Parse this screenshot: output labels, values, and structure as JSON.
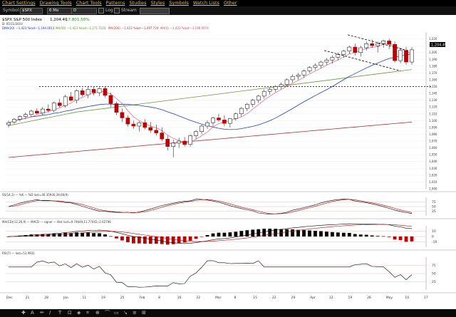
{
  "menu": [
    "Chart Settings",
    "Drawing Tools",
    "Chart Tools",
    "Patterns",
    "Studies",
    "Styles",
    "Symbols",
    "Watch Lists",
    "Other"
  ],
  "toolbar": {
    "symbol_label": "Symbol:",
    "symbol_value": "$SPX",
    "range_value": "6 Mo",
    "period_value": "D",
    "log_label": "Log",
    "stream_label": "Stream"
  },
  "header": {
    "title": "$SPX S&P 500 Index",
    "last_price": "1,204.49",
    "change": "17.80",
    "change_pct": "1.50%",
    "date_line": "D: 05/11/2010",
    "ma_line": "DMA(20) —1,423 %last—1,194.0013",
    "ma_line2": "MA(50) —1,423 %last—1,171.7103",
    "ma_line3": "MA(200) —1,423 %last—1,097.724",
    "ma_line4": "MA(5) —1,423 %last—1,199.5974"
  },
  "price_box": "1,204.49",
  "panels": {
    "stoch_label": "SS(14,3) — %K — %D last=46.35930,39.06(9)",
    "macd_label": "MA(CD)(12,26,9) — MACD — signal — Hist last=9.74649,11.77443,-2.02796",
    "rsi_label": "RSI(7) — last=53.9931"
  },
  "chart_data": {
    "type": "candlestick",
    "title": "$SPX S&P 500 Index",
    "last": 1204.49,
    "ylim": [
      1000,
      1230
    ],
    "y_ticks": [
      1000,
      1010,
      1020,
      1030,
      1040,
      1050,
      1060,
      1070,
      1080,
      1090,
      1100,
      1110,
      1120,
      1130,
      1140,
      1150,
      1160,
      1170,
      1180,
      1190,
      1200,
      1210,
      1220
    ],
    "x_ticks": [
      "Dec",
      "21",
      "28",
      "Jan",
      "11",
      "19",
      "25",
      "Feb",
      "8",
      "16",
      "22",
      "Mar",
      "8",
      "15",
      "22",
      "29",
      "Apr",
      "12",
      "19",
      "26",
      "May",
      "10",
      "17"
    ],
    "candles": [
      {
        "o": 1094,
        "h": 1100,
        "l": 1090,
        "c": 1097
      },
      {
        "o": 1098,
        "h": 1104,
        "l": 1095,
        "c": 1102
      },
      {
        "o": 1102,
        "h": 1108,
        "l": 1099,
        "c": 1106
      },
      {
        "o": 1106,
        "h": 1112,
        "l": 1102,
        "c": 1109
      },
      {
        "o": 1109,
        "h": 1116,
        "l": 1105,
        "c": 1114
      },
      {
        "o": 1114,
        "h": 1118,
        "l": 1109,
        "c": 1111
      },
      {
        "o": 1111,
        "h": 1120,
        "l": 1108,
        "c": 1117
      },
      {
        "o": 1117,
        "h": 1124,
        "l": 1112,
        "c": 1115
      },
      {
        "o": 1115,
        "h": 1128,
        "l": 1112,
        "c": 1126
      },
      {
        "o": 1126,
        "h": 1132,
        "l": 1119,
        "c": 1122
      },
      {
        "o": 1122,
        "h": 1138,
        "l": 1119,
        "c": 1135
      },
      {
        "o": 1135,
        "h": 1142,
        "l": 1128,
        "c": 1130
      },
      {
        "o": 1130,
        "h": 1146,
        "l": 1125,
        "c": 1144
      },
      {
        "o": 1144,
        "h": 1148,
        "l": 1135,
        "c": 1138
      },
      {
        "o": 1138,
        "h": 1150,
        "l": 1133,
        "c": 1146
      },
      {
        "o": 1146,
        "h": 1150,
        "l": 1137,
        "c": 1141
      },
      {
        "o": 1141,
        "h": 1149,
        "l": 1136,
        "c": 1147
      },
      {
        "o": 1147,
        "h": 1150,
        "l": 1134,
        "c": 1137
      },
      {
        "o": 1137,
        "h": 1141,
        "l": 1120,
        "c": 1125
      },
      {
        "o": 1125,
        "h": 1128,
        "l": 1108,
        "c": 1112
      },
      {
        "o": 1112,
        "h": 1118,
        "l": 1098,
        "c": 1104
      },
      {
        "o": 1104,
        "h": 1108,
        "l": 1091,
        "c": 1095
      },
      {
        "o": 1095,
        "h": 1100,
        "l": 1088,
        "c": 1092
      },
      {
        "o": 1092,
        "h": 1099,
        "l": 1084,
        "c": 1097
      },
      {
        "o": 1097,
        "h": 1102,
        "l": 1087,
        "c": 1090
      },
      {
        "o": 1090,
        "h": 1098,
        "l": 1082,
        "c": 1086
      },
      {
        "o": 1086,
        "h": 1094,
        "l": 1078,
        "c": 1082
      },
      {
        "o": 1082,
        "h": 1090,
        "l": 1070,
        "c": 1073
      },
      {
        "o": 1073,
        "h": 1078,
        "l": 1056,
        "c": 1062
      },
      {
        "o": 1062,
        "h": 1072,
        "l": 1046,
        "c": 1067
      },
      {
        "o": 1067,
        "h": 1075,
        "l": 1060,
        "c": 1070
      },
      {
        "o": 1070,
        "h": 1076,
        "l": 1062,
        "c": 1065
      },
      {
        "o": 1065,
        "h": 1080,
        "l": 1062,
        "c": 1078
      },
      {
        "o": 1078,
        "h": 1086,
        "l": 1073,
        "c": 1084
      },
      {
        "o": 1084,
        "h": 1094,
        "l": 1080,
        "c": 1092
      },
      {
        "o": 1092,
        "h": 1100,
        "l": 1088,
        "c": 1097
      },
      {
        "o": 1097,
        "h": 1106,
        "l": 1092,
        "c": 1104
      },
      {
        "o": 1104,
        "h": 1110,
        "l": 1098,
        "c": 1101
      },
      {
        "o": 1101,
        "h": 1108,
        "l": 1092,
        "c": 1096
      },
      {
        "o": 1096,
        "h": 1104,
        "l": 1090,
        "c": 1103
      },
      {
        "o": 1103,
        "h": 1112,
        "l": 1100,
        "c": 1110
      },
      {
        "o": 1110,
        "h": 1120,
        "l": 1106,
        "c": 1118
      },
      {
        "o": 1118,
        "h": 1126,
        "l": 1114,
        "c": 1124
      },
      {
        "o": 1124,
        "h": 1132,
        "l": 1120,
        "c": 1130
      },
      {
        "o": 1130,
        "h": 1138,
        "l": 1126,
        "c": 1136
      },
      {
        "o": 1136,
        "h": 1146,
        "l": 1132,
        "c": 1143
      },
      {
        "o": 1143,
        "h": 1149,
        "l": 1138,
        "c": 1146
      },
      {
        "o": 1146,
        "h": 1152,
        "l": 1142,
        "c": 1150
      },
      {
        "o": 1150,
        "h": 1156,
        "l": 1146,
        "c": 1153
      },
      {
        "o": 1153,
        "h": 1162,
        "l": 1150,
        "c": 1160
      },
      {
        "o": 1160,
        "h": 1168,
        "l": 1156,
        "c": 1165
      },
      {
        "o": 1165,
        "h": 1170,
        "l": 1160,
        "c": 1167
      },
      {
        "o": 1167,
        "h": 1175,
        "l": 1163,
        "c": 1173
      },
      {
        "o": 1173,
        "h": 1180,
        "l": 1170,
        "c": 1178
      },
      {
        "o": 1178,
        "h": 1184,
        "l": 1174,
        "c": 1181
      },
      {
        "o": 1181,
        "h": 1188,
        "l": 1177,
        "c": 1186
      },
      {
        "o": 1186,
        "h": 1192,
        "l": 1182,
        "c": 1189
      },
      {
        "o": 1189,
        "h": 1196,
        "l": 1184,
        "c": 1193
      },
      {
        "o": 1193,
        "h": 1200,
        "l": 1189,
        "c": 1197
      },
      {
        "o": 1197,
        "h": 1204,
        "l": 1192,
        "c": 1202
      },
      {
        "o": 1202,
        "h": 1210,
        "l": 1198,
        "c": 1208
      },
      {
        "o": 1208,
        "h": 1213,
        "l": 1196,
        "c": 1200
      },
      {
        "o": 1200,
        "h": 1210,
        "l": 1194,
        "c": 1207
      },
      {
        "o": 1207,
        "h": 1216,
        "l": 1203,
        "c": 1213
      },
      {
        "o": 1213,
        "h": 1219,
        "l": 1207,
        "c": 1210
      },
      {
        "o": 1210,
        "h": 1216,
        "l": 1200,
        "c": 1213
      },
      {
        "o": 1213,
        "h": 1219,
        "l": 1207,
        "c": 1217
      },
      {
        "o": 1217,
        "h": 1220,
        "l": 1205,
        "c": 1212
      },
      {
        "o": 1212,
        "h": 1216,
        "l": 1185,
        "c": 1188
      },
      {
        "o": 1188,
        "h": 1206,
        "l": 1184,
        "c": 1203
      },
      {
        "o": 1203,
        "h": 1208,
        "l": 1182,
        "c": 1186
      },
      {
        "o": 1186,
        "h": 1208,
        "l": 1182,
        "c": 1204
      }
    ],
    "hline": 1150,
    "stoch": {
      "levels": [
        75,
        50,
        25
      ],
      "ylim": [
        0,
        100
      ]
    },
    "macd": {
      "levels": [
        10,
        0,
        -10
      ],
      "ylim": [
        -20,
        20
      ]
    },
    "rsi": {
      "levels": [
        75,
        50,
        25
      ],
      "ylim": [
        0,
        100
      ]
    }
  },
  "bottom_tools": [
    "✚",
    "A",
    "✏",
    "∕",
    "T",
    "⊡",
    "◈",
    "⌗",
    "⊕",
    "⌒",
    "▭",
    "↘",
    "≡",
    "⊞"
  ]
}
